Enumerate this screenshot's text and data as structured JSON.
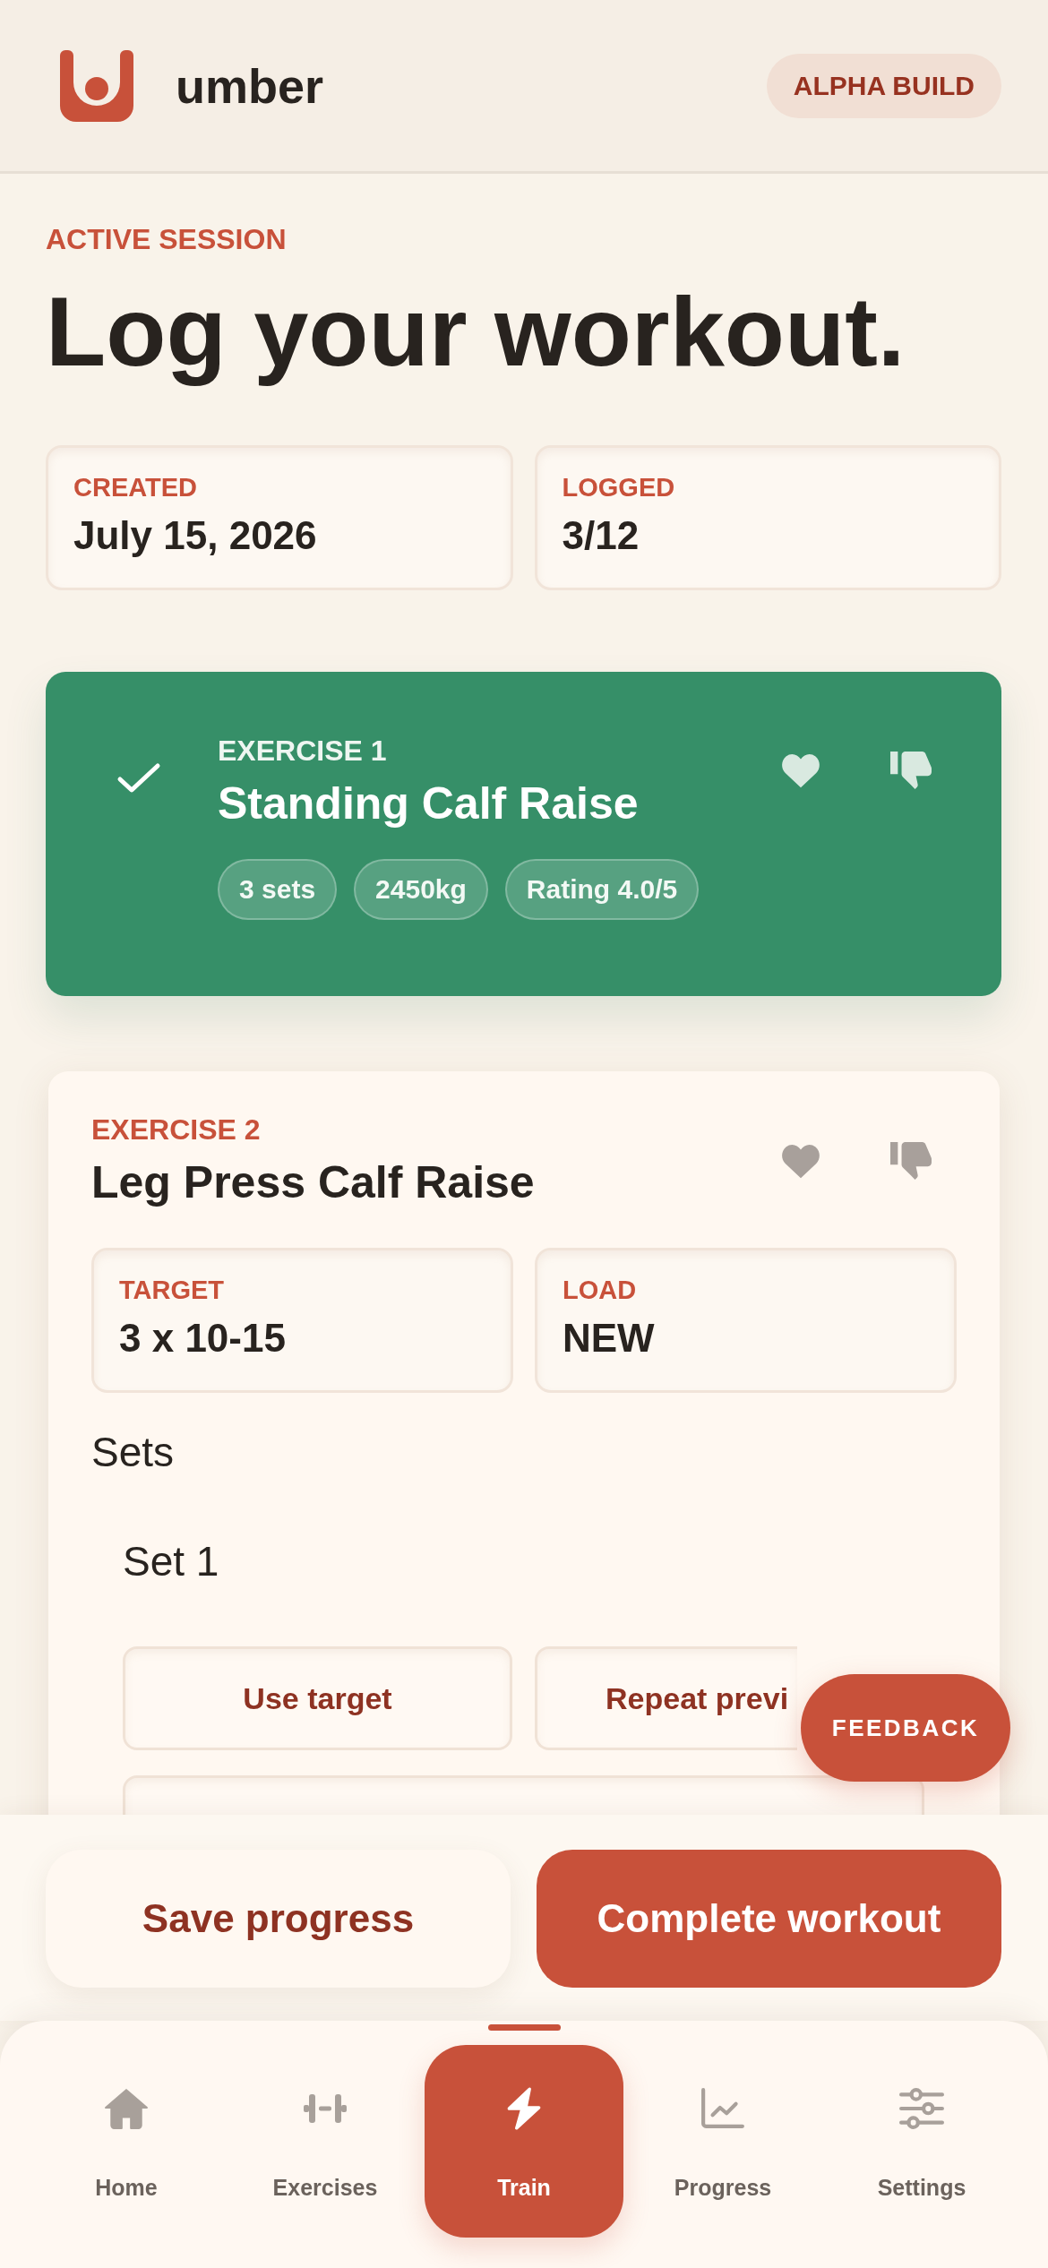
{
  "app_bar": {
    "brand": "umber",
    "badge": "ALPHA BUILD"
  },
  "session": {
    "eyebrow": "ACTIVE SESSION",
    "title": "Log your workout.",
    "stats": [
      {
        "label": "CREATED",
        "value": "July 15, 2026"
      },
      {
        "label": "LOGGED",
        "value": "3/12"
      }
    ]
  },
  "exercises": [
    {
      "label": "EXERCISE 1",
      "name": "Standing Calf Raise",
      "completed": true,
      "chips": [
        "3 sets",
        "2450kg",
        "Rating 4.0/5"
      ]
    },
    {
      "label": "EXERCISE 2",
      "name": "Leg Press Calf Raise",
      "completed": false,
      "details": [
        {
          "label": "TARGET",
          "value": "3 x 10-15"
        },
        {
          "label": "LOAD",
          "value": "NEW"
        }
      ],
      "sets_heading": "Sets",
      "sets": [
        {
          "title": "Set 1",
          "actions": [
            "Use target",
            "Repeat previ"
          ],
          "fields": [
            {
              "kind": "input"
            }
          ]
        }
      ]
    }
  ],
  "feedback_button": "FEEDBACK",
  "actions": [
    {
      "label": "Save progress",
      "kind": "secondary"
    },
    {
      "label": "Complete workout",
      "kind": "primary"
    }
  ],
  "bottom_nav": [
    {
      "label": "Home",
      "selected": false
    },
    {
      "label": "Exercises",
      "selected": false
    },
    {
      "label": "Train",
      "selected": true
    },
    {
      "label": "Progress",
      "selected": false
    },
    {
      "label": "Settings",
      "selected": false
    }
  ]
}
